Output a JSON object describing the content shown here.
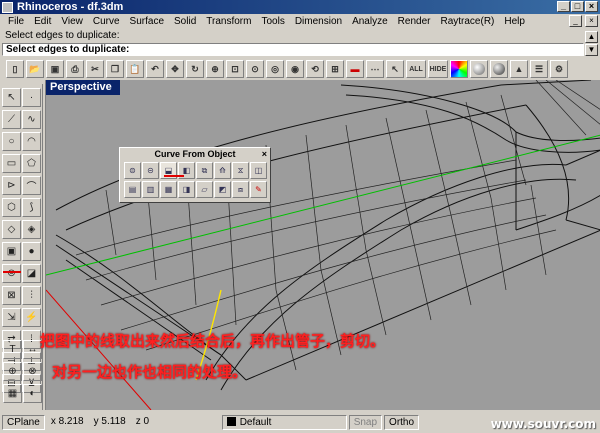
{
  "window": {
    "title": "Rhinoceros - df.3dm"
  },
  "menu": [
    "File",
    "Edit",
    "View",
    "Curve",
    "Surface",
    "Solid",
    "Transform",
    "Tools",
    "Dimension",
    "Analyze",
    "Render",
    "Raytrace(R)",
    "Help"
  ],
  "command": {
    "history": "Select edges to duplicate:",
    "prompt": "Select edges to duplicate:"
  },
  "toolbar": {
    "all_label": "ALL",
    "hide_label": "HIDE"
  },
  "viewport": {
    "label": "Perspective"
  },
  "panel": {
    "title": "Curve From Object",
    "close": "×"
  },
  "caption": {
    "line1": "把图中的线取出来然后结合后，再作出管子，剪切。",
    "line2": "对另一边也作也相同的处理。"
  },
  "status": {
    "cplane": "CPlane",
    "x": "x 8.218",
    "y": "y 5.118",
    "z": "z 0",
    "layer": "Default",
    "snap": "Snap",
    "ortho": "Ortho"
  },
  "watermark": "www.souvr.com",
  "colors": {
    "title_bar": "#0a246a",
    "viewport_bg": "#9c9c9c",
    "caption": "#ff2020",
    "x_axis": "#e00000",
    "y_axis": "#00c000"
  }
}
